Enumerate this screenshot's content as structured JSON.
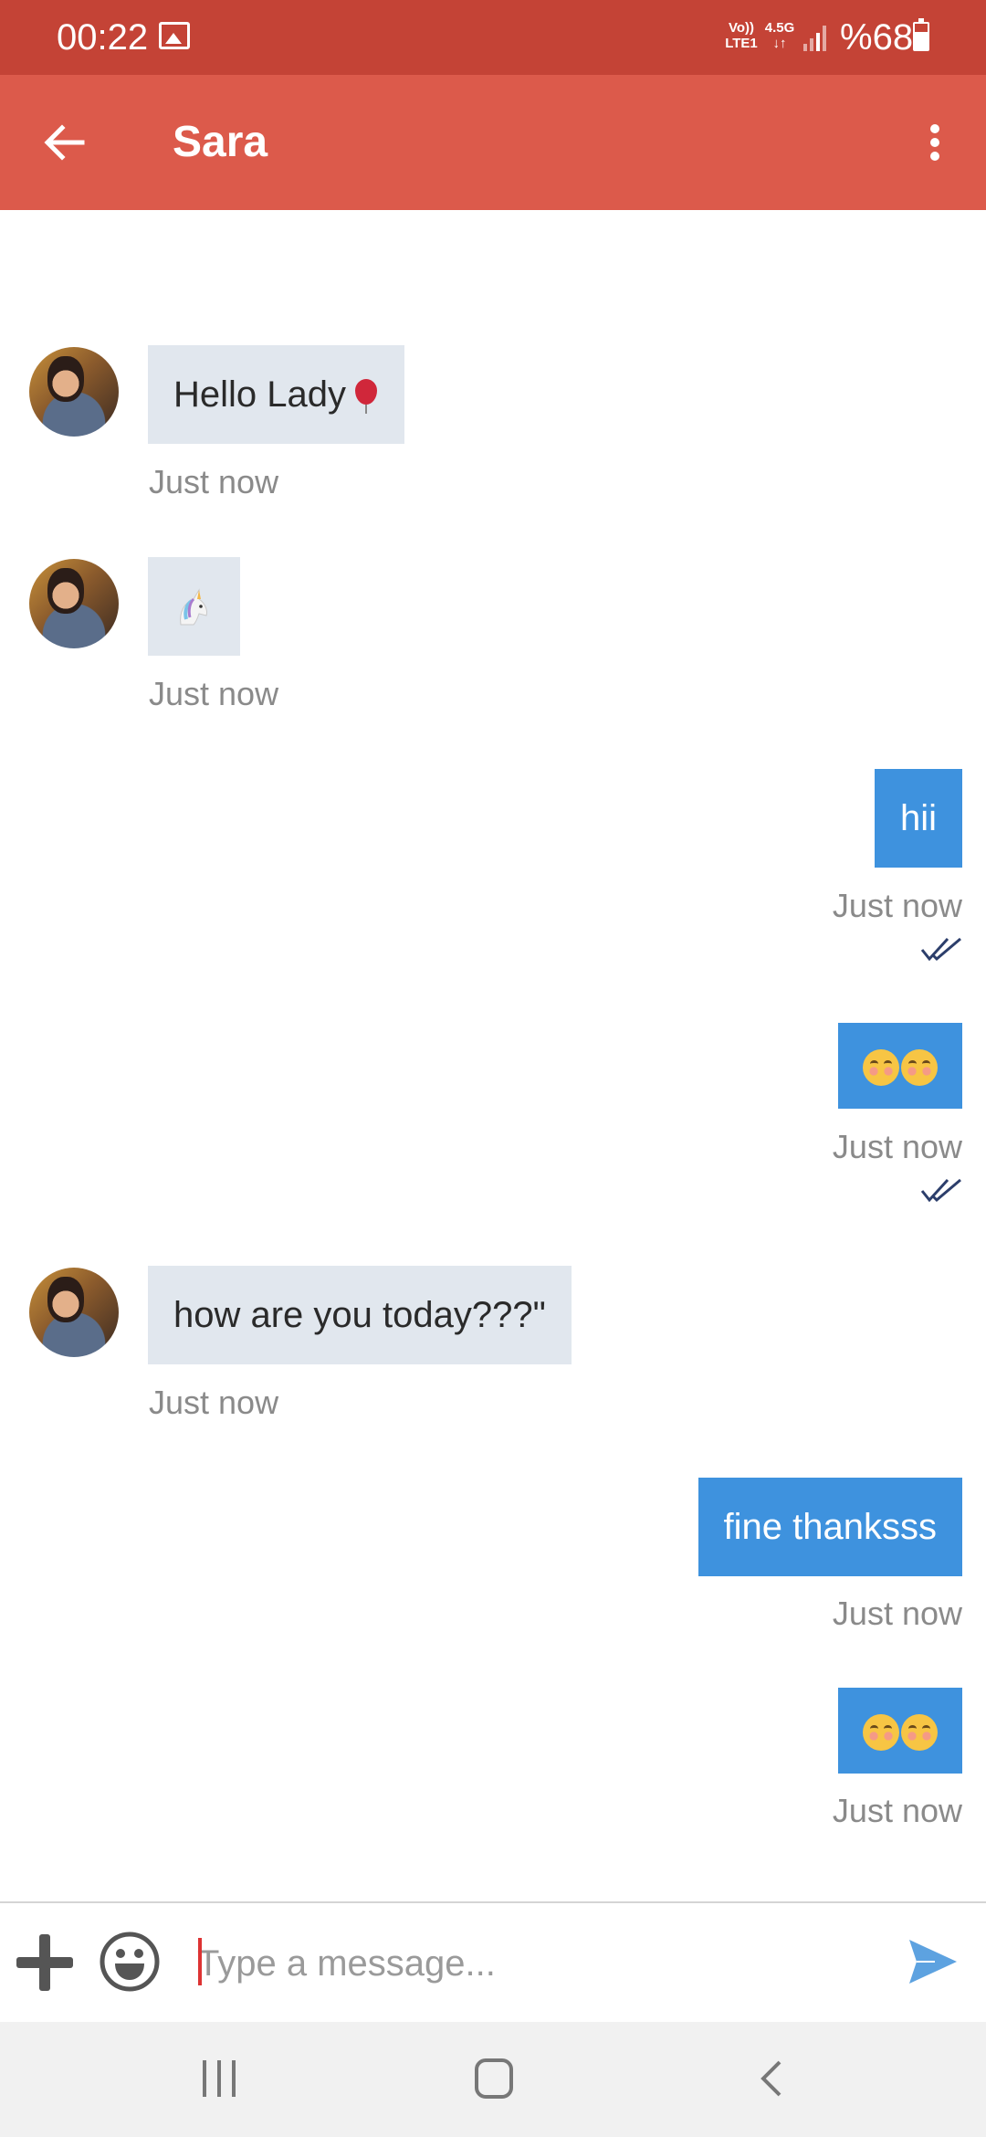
{
  "status_bar": {
    "time": "00:22",
    "network_top": "Vo))",
    "network_bottom": "LTE1",
    "network_type": "4.5G",
    "battery": "%68"
  },
  "header": {
    "title": "Sara"
  },
  "messages": [
    {
      "direction": "in",
      "text": "Hello Lady",
      "emoji": "balloon",
      "time": "Just now"
    },
    {
      "direction": "in",
      "text": "",
      "emoji": "unicorn",
      "time": "Just now"
    },
    {
      "direction": "out",
      "text": "hii",
      "time": "Just now",
      "read": true
    },
    {
      "direction": "out",
      "text": "",
      "emoji": "blush-blush",
      "time": "Just now",
      "read": true
    },
    {
      "direction": "in",
      "text": "how are you today???\"",
      "time": "Just now"
    },
    {
      "direction": "out",
      "text": "fine thanksss",
      "time": "Just now"
    },
    {
      "direction": "out",
      "text": "",
      "emoji": "blush-blush",
      "time": "Just now"
    }
  ],
  "composer": {
    "placeholder": "Type a message..."
  },
  "colors": {
    "status_bar": "#c44336",
    "app_bar": "#dc5a4b",
    "outgoing_bubble": "#3e92de",
    "incoming_bubble": "#e1e7ee",
    "send_icon": "#5da2e0"
  },
  "icons": [
    "back-arrow-icon",
    "more-vert-icon",
    "add-icon",
    "emoji-icon",
    "send-icon",
    "double-check-icon"
  ]
}
